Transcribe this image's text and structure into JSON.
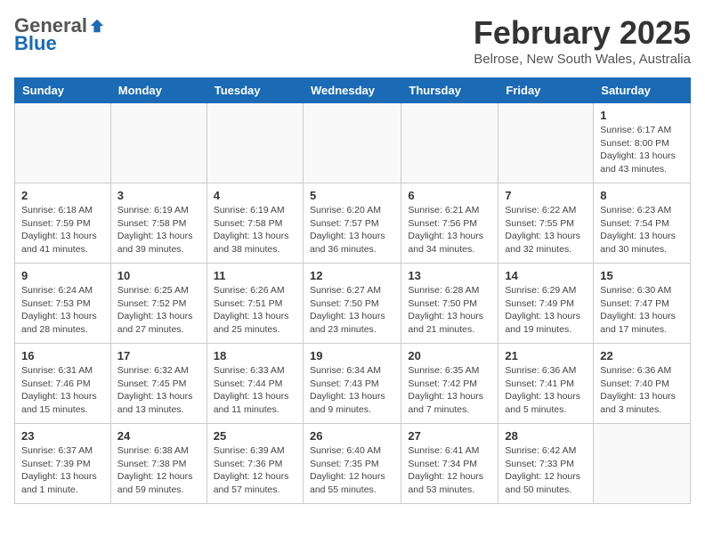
{
  "header": {
    "logo_general": "General",
    "logo_blue": "Blue",
    "month_title": "February 2025",
    "location": "Belrose, New South Wales, Australia"
  },
  "days_of_week": [
    "Sunday",
    "Monday",
    "Tuesday",
    "Wednesday",
    "Thursday",
    "Friday",
    "Saturday"
  ],
  "weeks": [
    [
      {
        "day": "",
        "info": ""
      },
      {
        "day": "",
        "info": ""
      },
      {
        "day": "",
        "info": ""
      },
      {
        "day": "",
        "info": ""
      },
      {
        "day": "",
        "info": ""
      },
      {
        "day": "",
        "info": ""
      },
      {
        "day": "1",
        "info": "Sunrise: 6:17 AM\nSunset: 8:00 PM\nDaylight: 13 hours and 43 minutes."
      }
    ],
    [
      {
        "day": "2",
        "info": "Sunrise: 6:18 AM\nSunset: 7:59 PM\nDaylight: 13 hours and 41 minutes."
      },
      {
        "day": "3",
        "info": "Sunrise: 6:19 AM\nSunset: 7:58 PM\nDaylight: 13 hours and 39 minutes."
      },
      {
        "day": "4",
        "info": "Sunrise: 6:19 AM\nSunset: 7:58 PM\nDaylight: 13 hours and 38 minutes."
      },
      {
        "day": "5",
        "info": "Sunrise: 6:20 AM\nSunset: 7:57 PM\nDaylight: 13 hours and 36 minutes."
      },
      {
        "day": "6",
        "info": "Sunrise: 6:21 AM\nSunset: 7:56 PM\nDaylight: 13 hours and 34 minutes."
      },
      {
        "day": "7",
        "info": "Sunrise: 6:22 AM\nSunset: 7:55 PM\nDaylight: 13 hours and 32 minutes."
      },
      {
        "day": "8",
        "info": "Sunrise: 6:23 AM\nSunset: 7:54 PM\nDaylight: 13 hours and 30 minutes."
      }
    ],
    [
      {
        "day": "9",
        "info": "Sunrise: 6:24 AM\nSunset: 7:53 PM\nDaylight: 13 hours and 28 minutes."
      },
      {
        "day": "10",
        "info": "Sunrise: 6:25 AM\nSunset: 7:52 PM\nDaylight: 13 hours and 27 minutes."
      },
      {
        "day": "11",
        "info": "Sunrise: 6:26 AM\nSunset: 7:51 PM\nDaylight: 13 hours and 25 minutes."
      },
      {
        "day": "12",
        "info": "Sunrise: 6:27 AM\nSunset: 7:50 PM\nDaylight: 13 hours and 23 minutes."
      },
      {
        "day": "13",
        "info": "Sunrise: 6:28 AM\nSunset: 7:50 PM\nDaylight: 13 hours and 21 minutes."
      },
      {
        "day": "14",
        "info": "Sunrise: 6:29 AM\nSunset: 7:49 PM\nDaylight: 13 hours and 19 minutes."
      },
      {
        "day": "15",
        "info": "Sunrise: 6:30 AM\nSunset: 7:47 PM\nDaylight: 13 hours and 17 minutes."
      }
    ],
    [
      {
        "day": "16",
        "info": "Sunrise: 6:31 AM\nSunset: 7:46 PM\nDaylight: 13 hours and 15 minutes."
      },
      {
        "day": "17",
        "info": "Sunrise: 6:32 AM\nSunset: 7:45 PM\nDaylight: 13 hours and 13 minutes."
      },
      {
        "day": "18",
        "info": "Sunrise: 6:33 AM\nSunset: 7:44 PM\nDaylight: 13 hours and 11 minutes."
      },
      {
        "day": "19",
        "info": "Sunrise: 6:34 AM\nSunset: 7:43 PM\nDaylight: 13 hours and 9 minutes."
      },
      {
        "day": "20",
        "info": "Sunrise: 6:35 AM\nSunset: 7:42 PM\nDaylight: 13 hours and 7 minutes."
      },
      {
        "day": "21",
        "info": "Sunrise: 6:36 AM\nSunset: 7:41 PM\nDaylight: 13 hours and 5 minutes."
      },
      {
        "day": "22",
        "info": "Sunrise: 6:36 AM\nSunset: 7:40 PM\nDaylight: 13 hours and 3 minutes."
      }
    ],
    [
      {
        "day": "23",
        "info": "Sunrise: 6:37 AM\nSunset: 7:39 PM\nDaylight: 13 hours and 1 minute."
      },
      {
        "day": "24",
        "info": "Sunrise: 6:38 AM\nSunset: 7:38 PM\nDaylight: 12 hours and 59 minutes."
      },
      {
        "day": "25",
        "info": "Sunrise: 6:39 AM\nSunset: 7:36 PM\nDaylight: 12 hours and 57 minutes."
      },
      {
        "day": "26",
        "info": "Sunrise: 6:40 AM\nSunset: 7:35 PM\nDaylight: 12 hours and 55 minutes."
      },
      {
        "day": "27",
        "info": "Sunrise: 6:41 AM\nSunset: 7:34 PM\nDaylight: 12 hours and 53 minutes."
      },
      {
        "day": "28",
        "info": "Sunrise: 6:42 AM\nSunset: 7:33 PM\nDaylight: 12 hours and 50 minutes."
      },
      {
        "day": "",
        "info": ""
      }
    ]
  ]
}
